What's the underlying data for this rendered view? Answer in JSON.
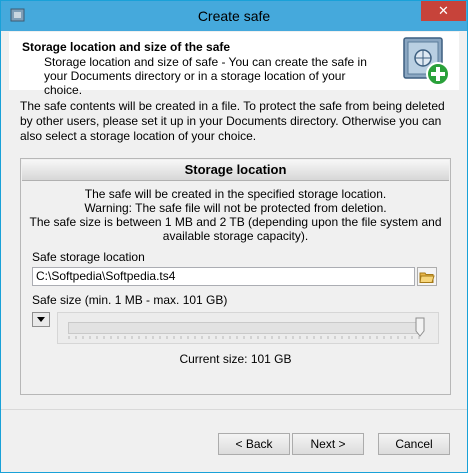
{
  "window": {
    "title": "Create safe",
    "close_glyph": "✕"
  },
  "header": {
    "title": "Storage location and size of the safe",
    "subtitle": "Storage location and size of safe - You can create the safe in your Documents directory or in a storage location of your choice."
  },
  "intro": "The safe contents will be created in a file. To protect the safe from being deleted by other users, please set it up in your Documents directory. Otherwise you can also select a storage location of your choice.",
  "storage": {
    "heading": "Storage location",
    "line1": "The safe will be created in the specified storage location.",
    "line2": "Warning: The safe file will not be protected from deletion.",
    "line3": "The safe size is between 1 MB and 2 TB (depending upon the file system and available storage capacity).",
    "path_label": "Safe storage location",
    "path_value": "C:\\Softpedia\\Softpedia.ts4",
    "size_label": "Safe size (min. 1 MB - max. 101 GB)",
    "current_size": "Current size: 101 GB",
    "slider_fraction": 1.0
  },
  "buttons": {
    "back": "< Back",
    "next": "Next >",
    "cancel": "Cancel"
  },
  "icons": {
    "app": "app-icon",
    "safe": "safe-add-icon",
    "browse": "folder-open-icon",
    "dropdown": "triangle-down-icon"
  },
  "colors": {
    "titlebar": "#45a9dc",
    "close": "#c7433a",
    "accent_green": "#2aa13a"
  }
}
